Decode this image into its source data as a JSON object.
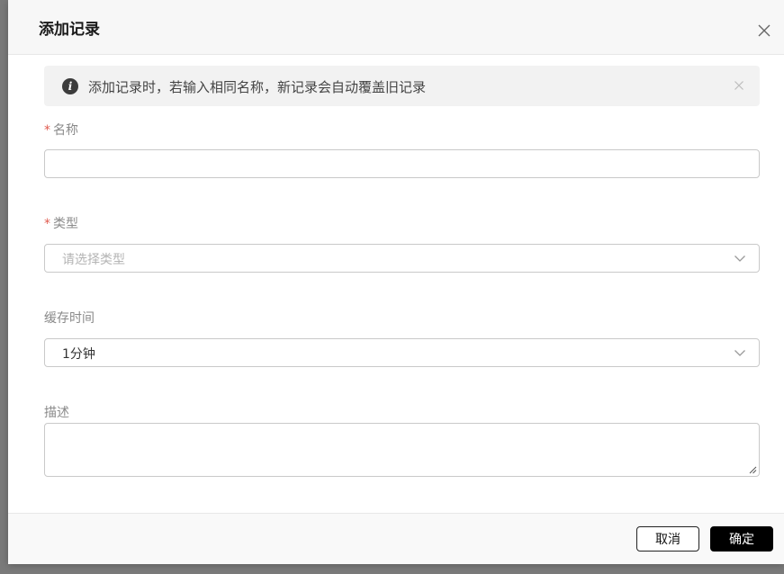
{
  "dialog": {
    "title": "添加记录",
    "close_icon": "close-icon"
  },
  "alert": {
    "icon": "info-icon",
    "text": "添加记录时，若输入相同名称，新记录会自动覆盖旧记录",
    "close_icon": "close-icon"
  },
  "form": {
    "name": {
      "required_mark": "*",
      "label": "名称",
      "value": "",
      "placeholder": ""
    },
    "type": {
      "required_mark": "*",
      "label": "类型",
      "placeholder": "请选择类型",
      "icon": "chevron-down-icon"
    },
    "cache_time": {
      "label": "缓存时间",
      "value": "1分钟",
      "icon": "chevron-down-icon"
    },
    "description": {
      "label": "描述",
      "value": ""
    }
  },
  "footer": {
    "cancel_label": "取消",
    "ok_label": "确定"
  },
  "colors": {
    "required": "#e05a4f",
    "primary_button": "#000000",
    "alert_bg": "#f2f2f2"
  }
}
